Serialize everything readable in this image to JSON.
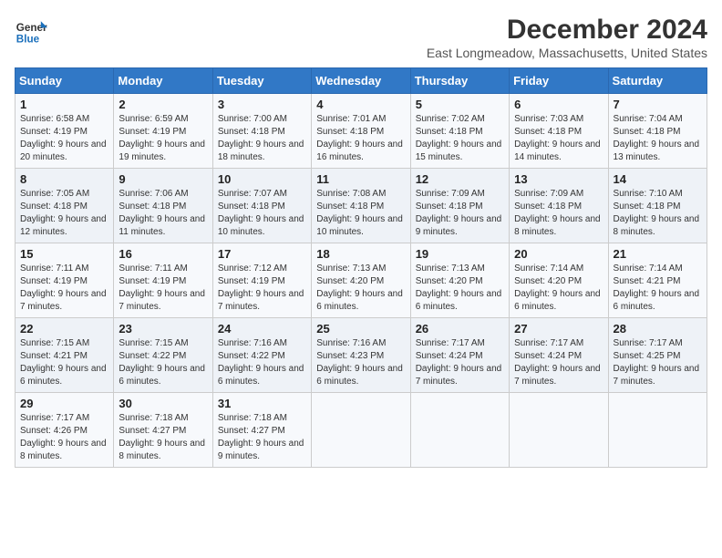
{
  "header": {
    "logo_line1": "General",
    "logo_line2": "Blue",
    "title": "December 2024",
    "subtitle": "East Longmeadow, Massachusetts, United States"
  },
  "columns": [
    "Sunday",
    "Monday",
    "Tuesday",
    "Wednesday",
    "Thursday",
    "Friday",
    "Saturday"
  ],
  "weeks": [
    [
      {
        "day": "1",
        "sunrise": "Sunrise: 6:58 AM",
        "sunset": "Sunset: 4:19 PM",
        "daylight": "Daylight: 9 hours and 20 minutes."
      },
      {
        "day": "2",
        "sunrise": "Sunrise: 6:59 AM",
        "sunset": "Sunset: 4:19 PM",
        "daylight": "Daylight: 9 hours and 19 minutes."
      },
      {
        "day": "3",
        "sunrise": "Sunrise: 7:00 AM",
        "sunset": "Sunset: 4:18 PM",
        "daylight": "Daylight: 9 hours and 18 minutes."
      },
      {
        "day": "4",
        "sunrise": "Sunrise: 7:01 AM",
        "sunset": "Sunset: 4:18 PM",
        "daylight": "Daylight: 9 hours and 16 minutes."
      },
      {
        "day": "5",
        "sunrise": "Sunrise: 7:02 AM",
        "sunset": "Sunset: 4:18 PM",
        "daylight": "Daylight: 9 hours and 15 minutes."
      },
      {
        "day": "6",
        "sunrise": "Sunrise: 7:03 AM",
        "sunset": "Sunset: 4:18 PM",
        "daylight": "Daylight: 9 hours and 14 minutes."
      },
      {
        "day": "7",
        "sunrise": "Sunrise: 7:04 AM",
        "sunset": "Sunset: 4:18 PM",
        "daylight": "Daylight: 9 hours and 13 minutes."
      }
    ],
    [
      {
        "day": "8",
        "sunrise": "Sunrise: 7:05 AM",
        "sunset": "Sunset: 4:18 PM",
        "daylight": "Daylight: 9 hours and 12 minutes."
      },
      {
        "day": "9",
        "sunrise": "Sunrise: 7:06 AM",
        "sunset": "Sunset: 4:18 PM",
        "daylight": "Daylight: 9 hours and 11 minutes."
      },
      {
        "day": "10",
        "sunrise": "Sunrise: 7:07 AM",
        "sunset": "Sunset: 4:18 PM",
        "daylight": "Daylight: 9 hours and 10 minutes."
      },
      {
        "day": "11",
        "sunrise": "Sunrise: 7:08 AM",
        "sunset": "Sunset: 4:18 PM",
        "daylight": "Daylight: 9 hours and 10 minutes."
      },
      {
        "day": "12",
        "sunrise": "Sunrise: 7:09 AM",
        "sunset": "Sunset: 4:18 PM",
        "daylight": "Daylight: 9 hours and 9 minutes."
      },
      {
        "day": "13",
        "sunrise": "Sunrise: 7:09 AM",
        "sunset": "Sunset: 4:18 PM",
        "daylight": "Daylight: 9 hours and 8 minutes."
      },
      {
        "day": "14",
        "sunrise": "Sunrise: 7:10 AM",
        "sunset": "Sunset: 4:18 PM",
        "daylight": "Daylight: 9 hours and 8 minutes."
      }
    ],
    [
      {
        "day": "15",
        "sunrise": "Sunrise: 7:11 AM",
        "sunset": "Sunset: 4:19 PM",
        "daylight": "Daylight: 9 hours and 7 minutes."
      },
      {
        "day": "16",
        "sunrise": "Sunrise: 7:11 AM",
        "sunset": "Sunset: 4:19 PM",
        "daylight": "Daylight: 9 hours and 7 minutes."
      },
      {
        "day": "17",
        "sunrise": "Sunrise: 7:12 AM",
        "sunset": "Sunset: 4:19 PM",
        "daylight": "Daylight: 9 hours and 7 minutes."
      },
      {
        "day": "18",
        "sunrise": "Sunrise: 7:13 AM",
        "sunset": "Sunset: 4:20 PM",
        "daylight": "Daylight: 9 hours and 6 minutes."
      },
      {
        "day": "19",
        "sunrise": "Sunrise: 7:13 AM",
        "sunset": "Sunset: 4:20 PM",
        "daylight": "Daylight: 9 hours and 6 minutes."
      },
      {
        "day": "20",
        "sunrise": "Sunrise: 7:14 AM",
        "sunset": "Sunset: 4:20 PM",
        "daylight": "Daylight: 9 hours and 6 minutes."
      },
      {
        "day": "21",
        "sunrise": "Sunrise: 7:14 AM",
        "sunset": "Sunset: 4:21 PM",
        "daylight": "Daylight: 9 hours and 6 minutes."
      }
    ],
    [
      {
        "day": "22",
        "sunrise": "Sunrise: 7:15 AM",
        "sunset": "Sunset: 4:21 PM",
        "daylight": "Daylight: 9 hours and 6 minutes."
      },
      {
        "day": "23",
        "sunrise": "Sunrise: 7:15 AM",
        "sunset": "Sunset: 4:22 PM",
        "daylight": "Daylight: 9 hours and 6 minutes."
      },
      {
        "day": "24",
        "sunrise": "Sunrise: 7:16 AM",
        "sunset": "Sunset: 4:22 PM",
        "daylight": "Daylight: 9 hours and 6 minutes."
      },
      {
        "day": "25",
        "sunrise": "Sunrise: 7:16 AM",
        "sunset": "Sunset: 4:23 PM",
        "daylight": "Daylight: 9 hours and 6 minutes."
      },
      {
        "day": "26",
        "sunrise": "Sunrise: 7:17 AM",
        "sunset": "Sunset: 4:24 PM",
        "daylight": "Daylight: 9 hours and 7 minutes."
      },
      {
        "day": "27",
        "sunrise": "Sunrise: 7:17 AM",
        "sunset": "Sunset: 4:24 PM",
        "daylight": "Daylight: 9 hours and 7 minutes."
      },
      {
        "day": "28",
        "sunrise": "Sunrise: 7:17 AM",
        "sunset": "Sunset: 4:25 PM",
        "daylight": "Daylight: 9 hours and 7 minutes."
      }
    ],
    [
      {
        "day": "29",
        "sunrise": "Sunrise: 7:17 AM",
        "sunset": "Sunset: 4:26 PM",
        "daylight": "Daylight: 9 hours and 8 minutes."
      },
      {
        "day": "30",
        "sunrise": "Sunrise: 7:18 AM",
        "sunset": "Sunset: 4:27 PM",
        "daylight": "Daylight: 9 hours and 8 minutes."
      },
      {
        "day": "31",
        "sunrise": "Sunrise: 7:18 AM",
        "sunset": "Sunset: 4:27 PM",
        "daylight": "Daylight: 9 hours and 9 minutes."
      },
      null,
      null,
      null,
      null
    ]
  ]
}
